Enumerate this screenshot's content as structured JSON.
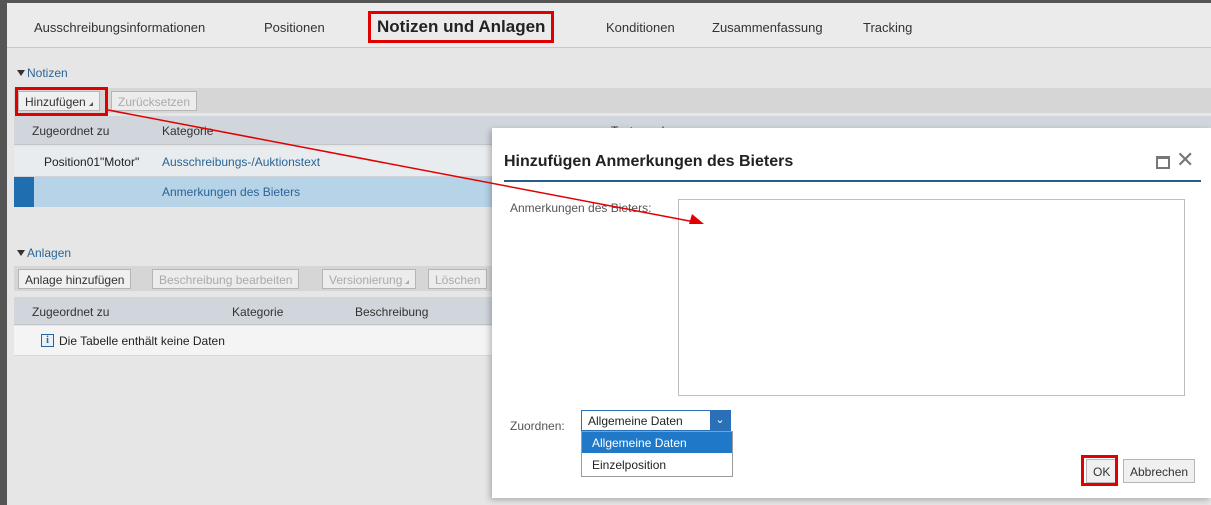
{
  "tabs": {
    "tab1": "Ausschreibungsinformationen",
    "tab2": "Positionen",
    "tab3": "Notizen und Anlagen",
    "tab4": "Konditionen",
    "tab5": "Zusammenfassung",
    "tab6": "Tracking"
  },
  "notes": {
    "section_title": "Notizen",
    "add_button": "Hinzufügen",
    "reset_button": "Zurücksetzen",
    "col_assigned": "Zugeordnet zu",
    "col_category": "Kategorie",
    "col_preview": "Textvorschau",
    "row1_assigned": "Position01\"Motor\"",
    "row1_category": "Ausschreibungs-/Auktionstext",
    "row2_category": "Anmerkungen des Bieters"
  },
  "attachments": {
    "section_title": "Anlagen",
    "add_button": "Anlage hinzufügen",
    "edit_desc_button": "Beschreibung bearbeiten",
    "versioning_button": "Versionierung",
    "delete_button": "Löschen",
    "col_assigned": "Zugeordnet zu",
    "col_category": "Kategorie",
    "col_description": "Beschreibung",
    "empty_message": "Die Tabelle enthält keine Daten"
  },
  "dialog": {
    "title": "Hinzufügen Anmerkungen des Bieters",
    "field_label": "Anmerkungen des Bieters:",
    "assign_label": "Zuordnen:",
    "assign_value": "Allgemeine Daten",
    "options": [
      "Allgemeine Daten",
      "Einzelposition"
    ],
    "ok_button": "OK",
    "cancel_button": "Abbrechen"
  },
  "colors": {
    "highlight": "#e00000",
    "accent": "#1f78c8",
    "selection_row": "#b6d3e8"
  }
}
